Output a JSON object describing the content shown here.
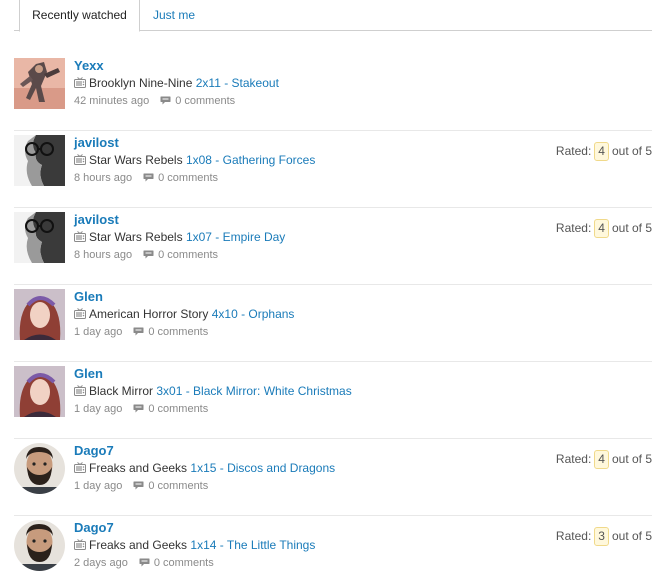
{
  "tabs": [
    {
      "label": "Recently watched",
      "active": true
    },
    {
      "label": "Just me",
      "active": false
    }
  ],
  "rated_prefix": "Rated:",
  "rated_suffix": "out of 5",
  "items": [
    {
      "user": "Yexx",
      "show": "Brooklyn Nine-Nine",
      "episode": "2x11 - Stakeout",
      "ago": "42 minutes ago",
      "comments": "0 comments",
      "rating": "",
      "avatar": "yexx"
    },
    {
      "user": "javilost",
      "show": "Star Wars Rebels",
      "episode": "1x08 - Gathering Forces",
      "ago": "8 hours ago",
      "comments": "0 comments",
      "rating": "4",
      "avatar": "javilost"
    },
    {
      "user": "javilost",
      "show": "Star Wars Rebels",
      "episode": "1x07 - Empire Day",
      "ago": "8 hours ago",
      "comments": "0 comments",
      "rating": "4",
      "avatar": "javilost"
    },
    {
      "user": "Glen",
      "show": "American Horror Story",
      "episode": "4x10 - Orphans",
      "ago": "1 day ago",
      "comments": "0 comments",
      "rating": "",
      "avatar": "glen"
    },
    {
      "user": "Glen",
      "show": "Black Mirror",
      "episode": "3x01 - Black Mirror: White Christmas",
      "ago": "1 day ago",
      "comments": "0 comments",
      "rating": "",
      "avatar": "glen"
    },
    {
      "user": "Dago7",
      "show": "Freaks and Geeks",
      "episode": "1x15 - Discos and Dragons",
      "ago": "1 day ago",
      "comments": "0 comments",
      "rating": "4",
      "avatar": "dago7"
    },
    {
      "user": "Dago7",
      "show": "Freaks and Geeks",
      "episode": "1x14 - The Little Things",
      "ago": "2 days ago",
      "comments": "0 comments",
      "rating": "3",
      "avatar": "dago7"
    }
  ],
  "icons": {
    "show": "tv-icon",
    "comments": "speech-bubble-icon"
  },
  "colors": {
    "link": "#1a7bb9",
    "muted": "#8a8a8a",
    "badge_bg": "#fff8dc",
    "badge_border": "#f0d98a"
  }
}
